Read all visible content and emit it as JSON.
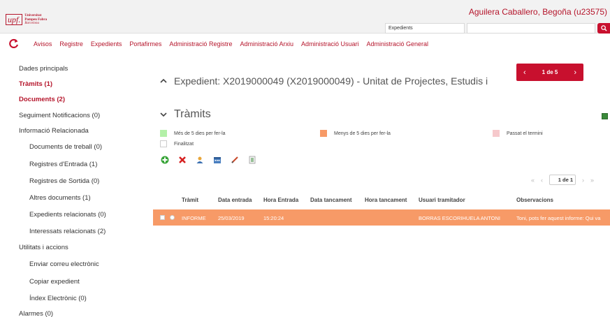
{
  "header": {
    "logo_mark": "upf.",
    "logo_line1": "Universitat",
    "logo_line2": "Pompeu Fabra",
    "logo_line3": "Barcelona",
    "user": "Aguilera Caballero, Begoña (u23575)",
    "search_type": "Expedients",
    "search_value": "",
    "search_icon": "search-icon",
    "accent_color": "#c8102e"
  },
  "nav": {
    "refresh_icon": "refresh-icon",
    "items": [
      "Avisos",
      "Registre",
      "Expedients",
      "Portafirmes",
      "Administració Registre",
      "Administració Arxiu",
      "Administració Usuari",
      "Administració General"
    ]
  },
  "sidebar": {
    "items": [
      {
        "label": "Dades principals"
      },
      {
        "label": "Tràmits (1)"
      },
      {
        "label": "Documents (2)"
      },
      {
        "label": "Seguiment Notificacions (0)"
      },
      {
        "label": "Informació Relacionada"
      },
      {
        "label": "Documents de treball (0)"
      },
      {
        "label": "Registres d'Entrada (1)"
      },
      {
        "label": "Registres de Sortida (0)"
      },
      {
        "label": "Altres documents (1)"
      },
      {
        "label": "Expedients relacionats (0)"
      },
      {
        "label": "Interessats relacionats (2)"
      },
      {
        "label": "Utilitats i accions"
      },
      {
        "label": "Enviar correu electrònic"
      },
      {
        "label": "Copiar expedient"
      },
      {
        "label": "Índex Electrònic (0)"
      },
      {
        "label": "Alarmes (0)"
      }
    ]
  },
  "main": {
    "expedient_title": "Expedient: X2019000049 (X2019000049) - Unitat de Projectes, Estudis i",
    "pager": {
      "current": "1 de 5"
    },
    "section_title": "Tràmits",
    "legend": [
      {
        "label": "Més de 5 dies per fer-la",
        "color": "#b3f0a8"
      },
      {
        "label": "Menys de 5 dies per fer-la",
        "color": "#f79a67"
      },
      {
        "label": "Passat el termini",
        "color": "#f6c9cc"
      },
      {
        "label": "Finalitzat",
        "color": "#ffffff"
      }
    ],
    "toolbar_icons": [
      "add-icon",
      "delete-icon",
      "user-icon",
      "calendar-icon",
      "edit-icon",
      "list-icon"
    ],
    "table_pager": {
      "page_label": "1 de 1"
    },
    "columns": [
      "Tràmit",
      "Data entrada",
      "Hora Entrada",
      "Data tancament",
      "Hora tancament",
      "Usuari tramitador",
      "Observacions"
    ],
    "rows": [
      {
        "tramit": "INFORME",
        "data_entrada": "25/03/2019",
        "hora_entrada": "15:20:24",
        "data_tancament": "",
        "hora_tancament": "",
        "usuari": "BORRAS ESCORIHUELA ANTONI",
        "observacions": "Toni, pots fer aquest informe: Qui va",
        "color": "#f79a67"
      }
    ]
  }
}
